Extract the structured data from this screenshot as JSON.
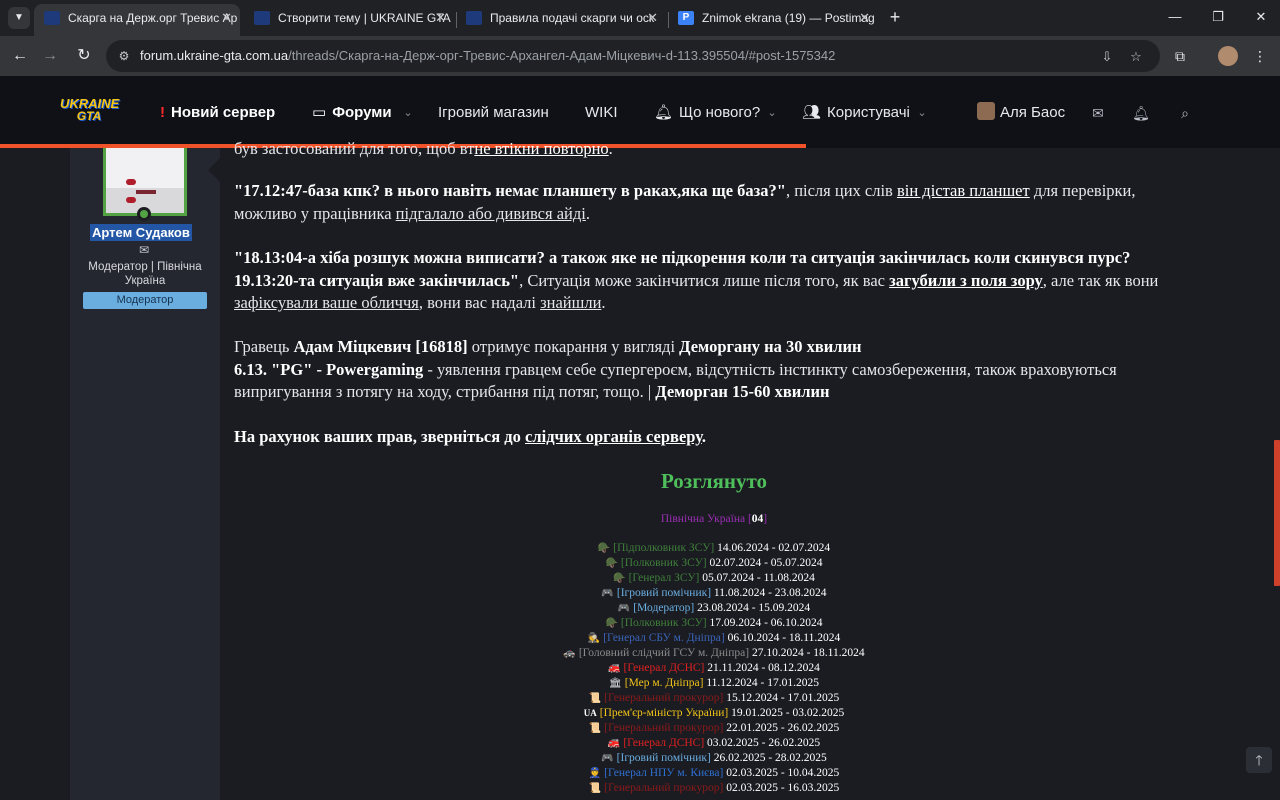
{
  "browser": {
    "tab_menu_icon": "chevron-down-icon",
    "tabs": [
      {
        "label": "Скарга на Держ.орг Тревис Ар",
        "active": true
      },
      {
        "label": "Створити тему | UKRAINE GTA",
        "active": false
      },
      {
        "label": "Правила подачі скарги чи оск",
        "active": false
      },
      {
        "label": "Znimok ekrana (19) — Postimag",
        "active": false
      }
    ],
    "new_tab": "+",
    "window_controls": {
      "minimize": "—",
      "maximize": "❐",
      "close": "✕"
    },
    "url_host": "forum.ukraine-gta.com.ua",
    "url_path": "/threads/Скарга-на-Держ-орг-Тревис-Архангел-Адам-Міцкевич-d-113.395504/#post-1575342"
  },
  "header": {
    "logo_line1": "UKRAINE",
    "logo_line2": "GTA",
    "nav": {
      "new_server": "Новий сервер",
      "forums": "Форуми",
      "shop": "Ігровий магазин",
      "wiki": "WIKI",
      "whats_new": "Що нового?",
      "users": "Користувачі",
      "username": "Аля Баос"
    },
    "progress_percent": 63
  },
  "post": {
    "author": {
      "name": "Артем Судаков",
      "role_text": "Модератор | Північна Україна",
      "badge": "Модератор"
    },
    "top_cut": {
      "pre": "був застосований для того, щоб вт",
      "link": "не втiкни повторно",
      "post": "."
    },
    "p1": {
      "quote": "\"17.12:47-база кпк? в нього навіть немає планшету в раках,яка ще база?\"",
      "t1": ", після цих слів ",
      "l1": "він дістав планшет",
      "t2": " для перевірки, можливо у працівника ",
      "l2": "підгалало або дивився айді",
      "t3": "."
    },
    "p2": {
      "quote": "\"18.13:04-а хіба розшук можна виписати? а також яке не підкорення коли та ситуація закінчилась коли скинувся пурс? 19.13:20-та ситуація вже закінчилась\"",
      "t1": ", Ситуація може закінчитися лише після того, як вас ",
      "l1": "загубили з поля зору",
      "t2": ", але так як вони ",
      "l2": "зафіксували ваше обличчя",
      "t3": ", вони вас надалі ",
      "l3": "знайшли",
      "t4": "."
    },
    "p3": {
      "t1": "Гравець ",
      "b1": "Адам Міцкевич [16818]",
      "t2": " отримує покарання у вигляді ",
      "b2": "Деморгану на 30 хвилин",
      "b3": "6.13. \"PG\" - Powergaming",
      "t3": " - уявлення гравцем себе супергероєм, відсутність інстинкту самозбереження, також враховуються випригування з потягу на ходу, стрибання під потяг, тощо. | ",
      "b4": "Деморган 15-60 хвилин"
    },
    "p4": {
      "b1": "На рахунок ваших прав, зверніться до ",
      "l1": "слідчих органів серверу",
      "b2": "."
    },
    "verdict": "Розглянуто",
    "region": {
      "name": "Північна Україна [",
      "num": "04",
      "close": "]"
    },
    "history": [
      {
        "icon": "🪖",
        "role": "[Підполковник ЗСУ]",
        "dates": "14.06.2024 - 02.07.2024",
        "color": "#3f7f3a"
      },
      {
        "icon": "🪖",
        "role": "[Полковник ЗСУ]",
        "dates": "02.07.2024 - 05.07.2024",
        "color": "#3f7f3a"
      },
      {
        "icon": "🪖",
        "role": "[Генерал ЗСУ]",
        "dates": "05.07.2024 - 11.08.2024",
        "color": "#3f7f3a"
      },
      {
        "icon": "🎮",
        "role": "[Ігровий помічник]",
        "dates": "11.08.2024 - 23.08.2024",
        "color": "#6aaee0"
      },
      {
        "icon": "🎮",
        "role": "[Модератор]",
        "dates": "23.08.2024 - 15.09.2024",
        "color": "#6aaee0"
      },
      {
        "icon": "🪖",
        "role": "[Полковник ЗСУ]",
        "dates": "17.09.2024 - 06.10.2024",
        "color": "#3f7f3a"
      },
      {
        "icon": "🕵",
        "role": "[Генерал СБУ м. Дніпра]",
        "dates": "06.10.2024 - 18.11.2024",
        "color": "#3a64b8"
      },
      {
        "icon": "🚓",
        "role": "[Головний слідчий ГСУ м. Дніпра]",
        "dates": "27.10.2024 - 18.11.2024",
        "color": "#8b8b8b"
      },
      {
        "icon": "🚒",
        "role": "[Генерал ДСНС]",
        "dates": "21.11.2024 - 08.12.2024",
        "color": "#e02020"
      },
      {
        "icon": "🏛",
        "role": "[Мер м. Дніпра]",
        "dates": "11.12.2024 - 17.01.2025",
        "color": "#f0c419"
      },
      {
        "icon": "📜",
        "role": "[Генеральний прокурор]",
        "dates": "15.12.2024 - 17.01.2025",
        "color": "#8b1a1a"
      },
      {
        "icon": "UA",
        "role": "[Прем'єр-міністр України]",
        "dates": "19.01.2025 - 03.02.2025",
        "color": "#f0c419"
      },
      {
        "icon": "📜",
        "role": "[Генеральний прокурор]",
        "dates": "22.01.2025 - 26.02.2025",
        "color": "#8b1a1a"
      },
      {
        "icon": "🚒",
        "role": "[Генерал ДСНС]",
        "dates": "03.02.2025 - 26.02.2025",
        "color": "#e02020"
      },
      {
        "icon": "🎮",
        "role": "[Ігровий помічник]",
        "dates": "26.02.2025 - 28.02.2025",
        "color": "#6aaee0"
      },
      {
        "icon": "👮",
        "role": "[Генерал НПУ м. Києва]",
        "dates": "02.03.2025 - 10.04.2025",
        "color": "#2f6fd0"
      },
      {
        "icon": "📜",
        "role": "[Генеральний прокурор]",
        "dates": "02.03.2025 - 16.03.2025",
        "color": "#8b1a1a"
      }
    ],
    "scroll_top_icon": "arrow-up-icon"
  }
}
